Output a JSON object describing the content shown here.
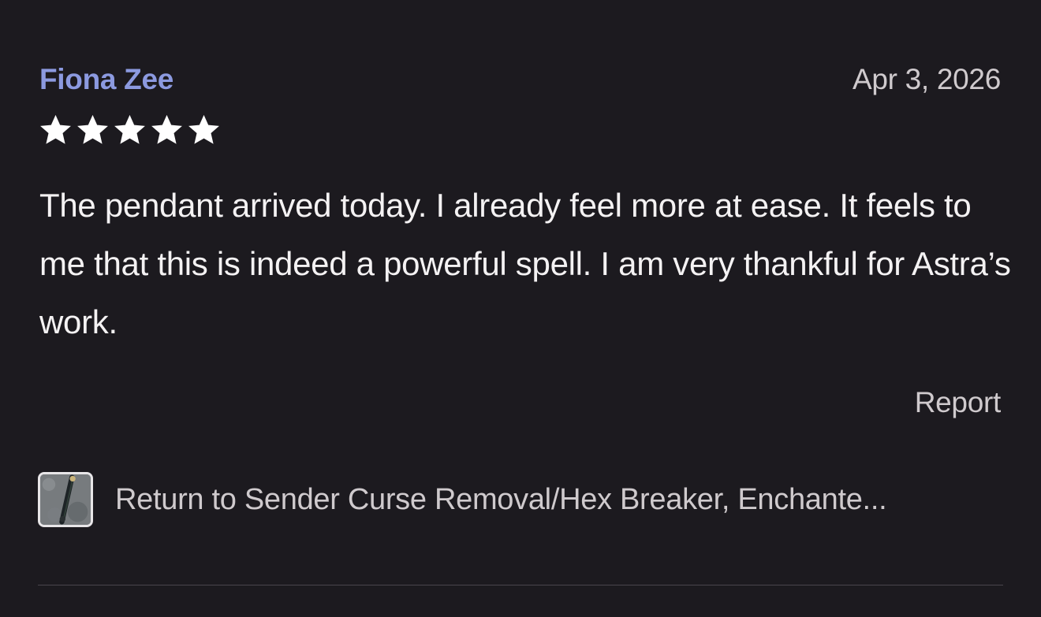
{
  "review": {
    "reviewer_name": "Fiona Zee",
    "date": "Apr 3, 2026",
    "rating": 5,
    "rating_max": 5,
    "body": "The pendant arrived today. I already feel more at ease. It feels to me that this is indeed a powerful spell. I am very thankful for Astra’s work.",
    "report_label": "Report"
  },
  "product": {
    "title": "Return to Sender Curse Removal/Hex Breaker, Enchante...",
    "thumbnail_icon": "pendant-photo-thumbnail"
  },
  "colors": {
    "background": "#1c1a1f",
    "reviewer_name": "#8c9ae0",
    "secondary_text": "#cfcacd",
    "body_text": "#f4f2f3",
    "star": "#ffffff",
    "divider": "#4a464c"
  }
}
